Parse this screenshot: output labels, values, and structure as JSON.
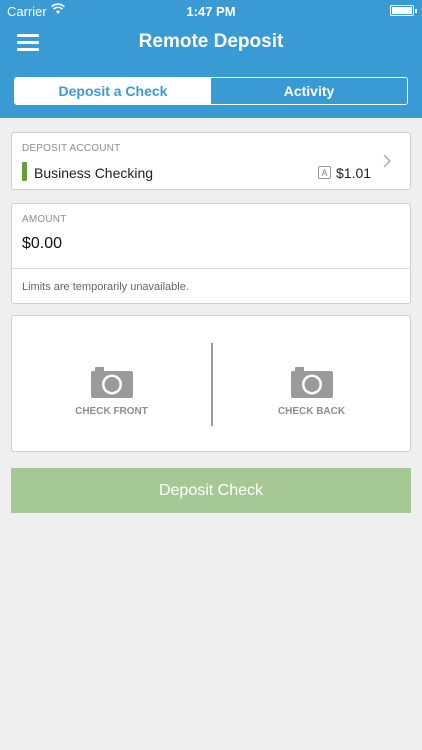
{
  "status_bar": {
    "carrier": "Carrier",
    "time": "1:47 PM",
    "wifi_icon": "wifi-icon",
    "battery_icon": "battery-icon"
  },
  "header": {
    "title": "Remote Deposit",
    "menu_icon": "hamburger-menu-icon",
    "background_color": "#3a9ad4"
  },
  "tabs": [
    {
      "label": "Deposit a Check",
      "active": true
    },
    {
      "label": "Activity",
      "active": false
    }
  ],
  "deposit_account": {
    "label": "DEPOSIT ACCOUNT",
    "account_name": "Business Checking",
    "badge": "A",
    "balance": "$1.01",
    "indicator_color": "#6a9c3a",
    "chevron_icon": "chevron-right-icon"
  },
  "amount": {
    "label": "AMOUNT",
    "value": "$0.00",
    "limits_text": "Limits are temporarily unavailable."
  },
  "check_images": {
    "front_label": "CHECK FRONT",
    "back_label": "CHECK BACK",
    "icon": "camera-icon"
  },
  "deposit_button": {
    "label": "Deposit Check",
    "color": "#a6c895"
  }
}
